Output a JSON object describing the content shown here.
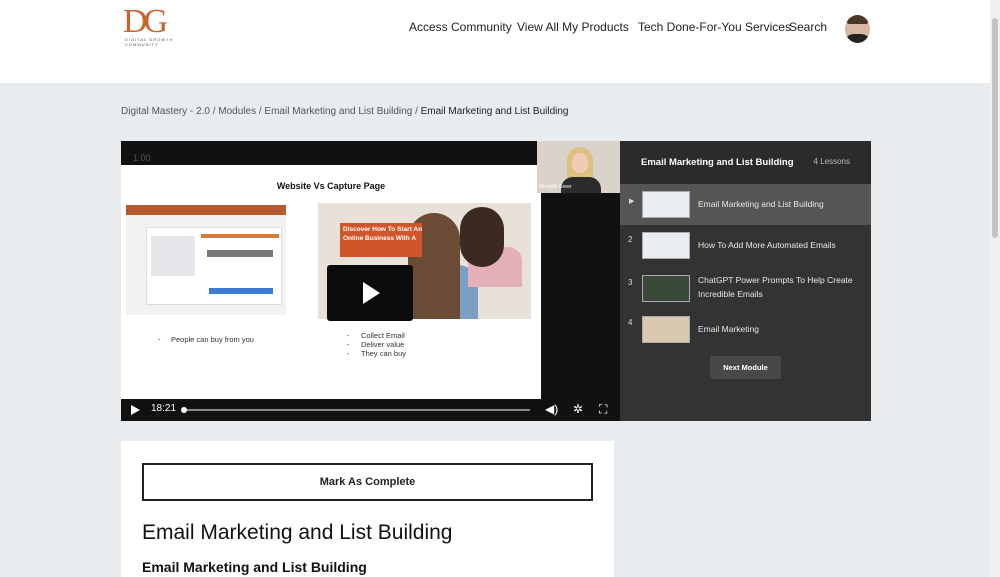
{
  "logo": {
    "monogram": "DG",
    "tagline": "DIGITAL GROWTH COMMUNITY"
  },
  "nav": {
    "items": [
      "Access Community",
      "View All My Products",
      "Tech Done-For-You Services",
      "Search"
    ]
  },
  "breadcrumb": {
    "parts": [
      "Digital Mastery - 2.0",
      "Modules",
      "Email Marketing and List Building"
    ],
    "current": "Email Marketing and List Building",
    "separator": "/"
  },
  "video": {
    "version_label": "1.00",
    "slide_title": "Website Vs Capture Page",
    "promo_text": "Discover How To Start An Online Business With A",
    "left_bullets": [
      "People can buy from you"
    ],
    "right_bullets": [
      "Collect Email",
      "Deliver value",
      "They can buy"
    ],
    "presenter_name": "Michelle Greer",
    "time": "18:21",
    "progress": 0.0,
    "icons": [
      "play-icon",
      "volume-icon",
      "settings-icon",
      "fullscreen-icon"
    ]
  },
  "playlist": {
    "title": "Email Marketing and List Building",
    "count": "4 Lessons",
    "items": [
      {
        "num": "",
        "label": "Email Marketing and List Building",
        "active": true
      },
      {
        "num": "2",
        "label": "How To Add More Automated Emails",
        "active": false
      },
      {
        "num": "3",
        "label": "ChatGPT Power Prompts To Help Create Incredible Emails",
        "active": false
      },
      {
        "num": "4",
        "label": "Email Marketing",
        "active": false
      }
    ],
    "next_button": "Next Module"
  },
  "content": {
    "complete_button": "Mark As Complete",
    "heading": "Email Marketing and List Building",
    "subheading": "Email Marketing and List Building"
  }
}
